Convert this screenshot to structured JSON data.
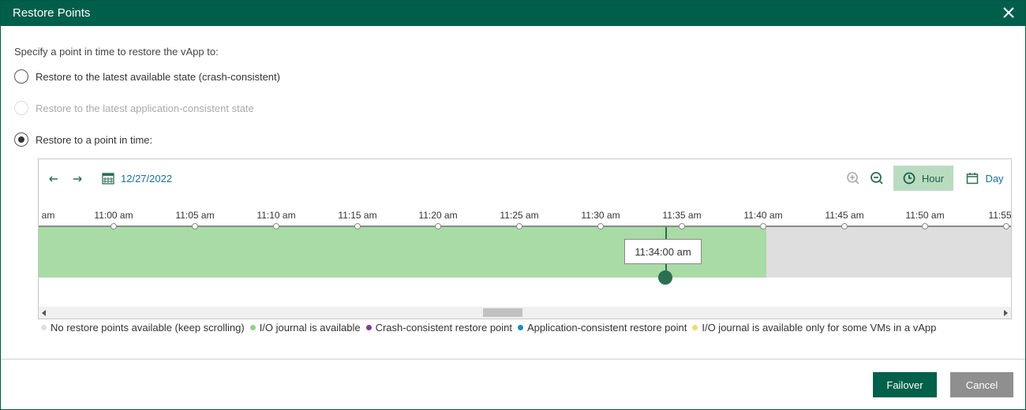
{
  "dialog": {
    "title": "Restore Points"
  },
  "prompt": "Specify a point in time to restore the vApp to:",
  "options": [
    {
      "label": "Restore to the latest available state (crash-consistent)",
      "checked": false,
      "disabled": false
    },
    {
      "label": "Restore to the latest application-consistent state",
      "checked": false,
      "disabled": true
    },
    {
      "label": "Restore to a point in time:",
      "checked": true,
      "disabled": false
    }
  ],
  "timeline": {
    "date": "12/27/2022",
    "zoom_hour_label": "Hour",
    "zoom_day_label": "Day",
    "ticks": [
      "am",
      "11:00 am",
      "11:05 am",
      "11:10 am",
      "11:15 am",
      "11:20 am",
      "11:25 am",
      "11:30 am",
      "11:35 am",
      "11:40 am",
      "11:45 am",
      "11:50 am",
      "11:55"
    ],
    "selected_time": "11:34:00 am"
  },
  "legend": [
    {
      "label": "No restore points available (keep scrolling)",
      "color": "#dedede"
    },
    {
      "label": "I/O journal is available",
      "color": "#8fd08b"
    },
    {
      "label": "Crash-consistent restore point",
      "color": "#7b3f8f"
    },
    {
      "label": "Application-consistent restore point",
      "color": "#1c8ac0"
    },
    {
      "label": "I/O journal is available only for some VMs in a vApp",
      "color": "#f5d86a"
    }
  ],
  "buttons": {
    "failover": "Failover",
    "cancel": "Cancel"
  },
  "colors": {
    "accent": "#005f4b",
    "link": "#1a6f9a"
  }
}
